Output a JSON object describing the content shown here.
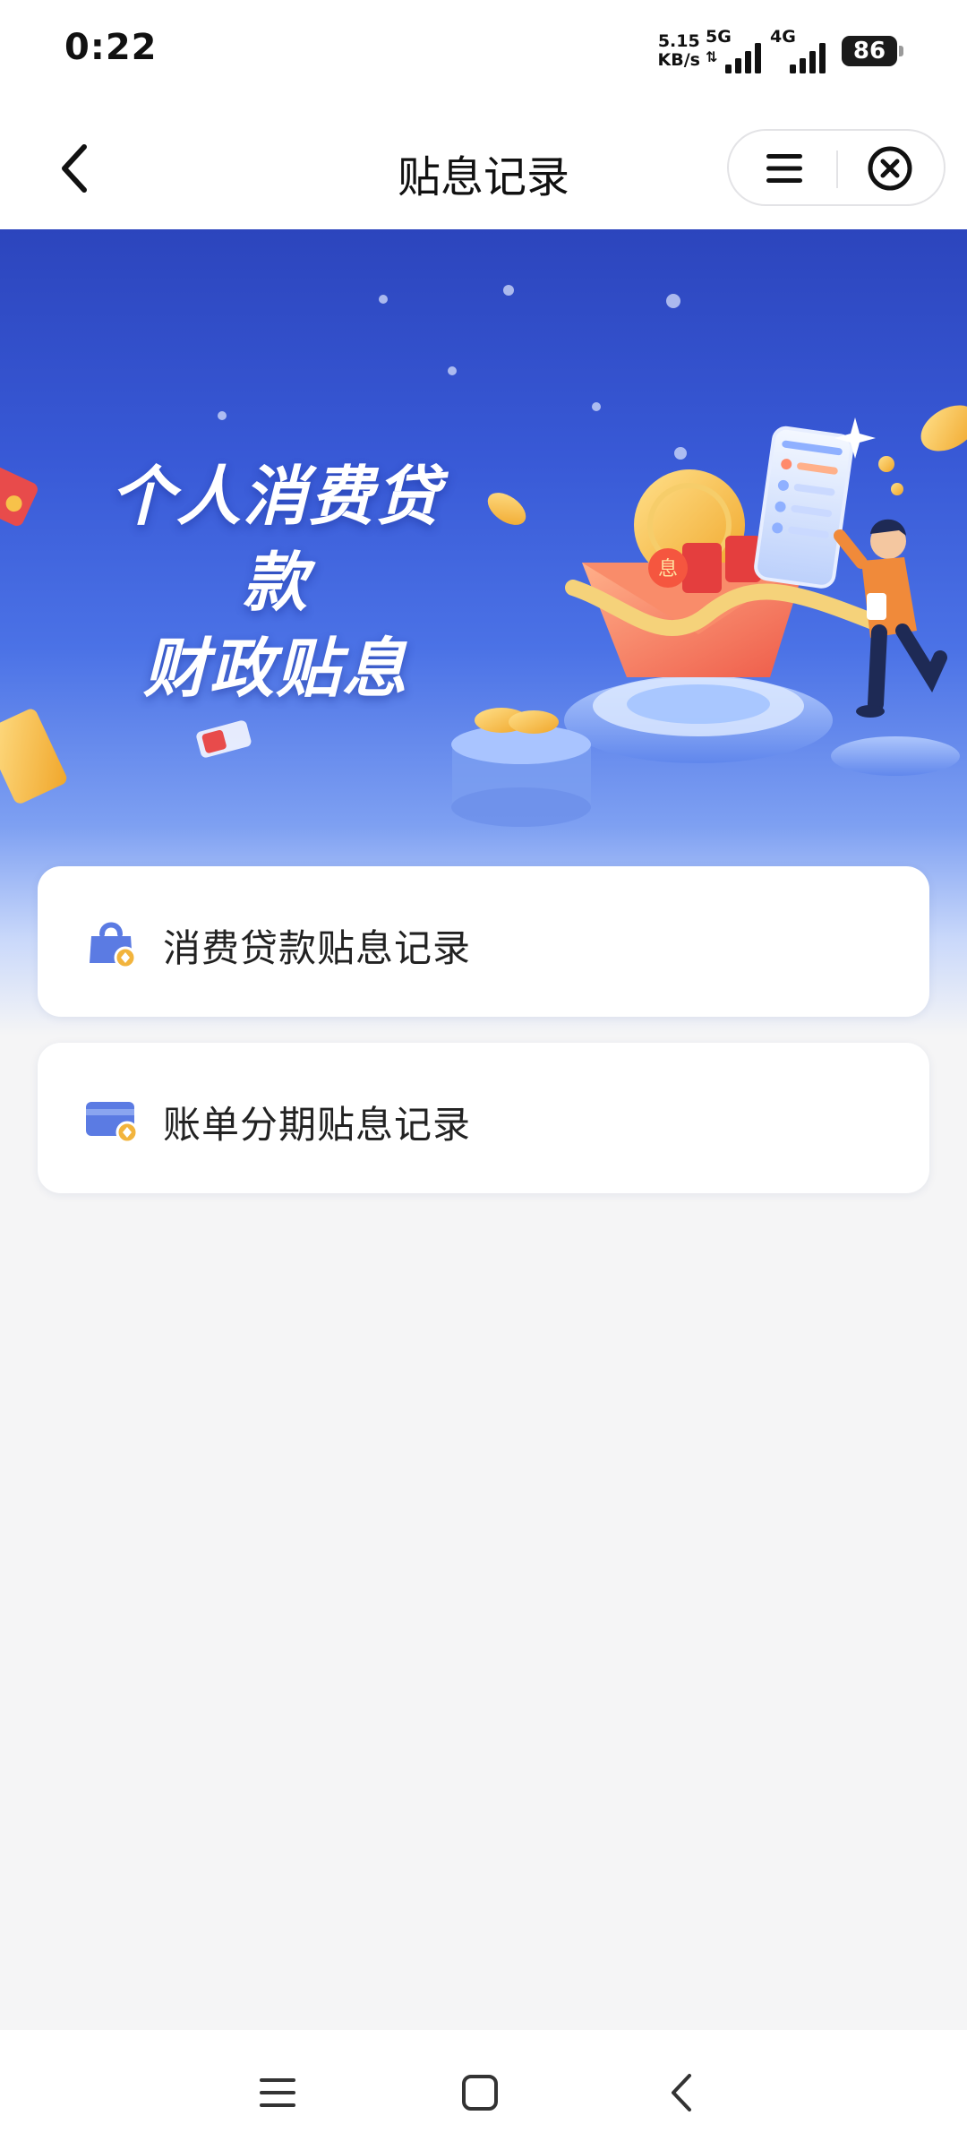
{
  "status_bar": {
    "time": "0:22",
    "net_speed_value": "5.15",
    "net_speed_unit": "KB/s",
    "signal_1_label": "5G",
    "signal_2_label": "4G",
    "battery_level": "86"
  },
  "header": {
    "title": "贴息记录",
    "back_icon": "chevron-left-icon",
    "menu_icon": "menu-icon",
    "close_icon": "close-circle-icon"
  },
  "banner": {
    "title_line1": "个人消费贷款",
    "title_line2": "财政贴息",
    "colors": {
      "top": "#2c45bd",
      "mid": "#4b72e6",
      "bottom": "#f5f5f6"
    }
  },
  "records": [
    {
      "label": "消费贷款贴息记录",
      "icon": "lock-bag-icon"
    },
    {
      "label": "账单分期贴息记录",
      "icon": "credit-card-icon"
    }
  ],
  "nav_bar": {
    "menu_icon": "recents-menu-icon",
    "home_icon": "home-square-icon",
    "back_icon": "back-chevron-icon"
  },
  "colors": {
    "accent_blue": "#5b7be3",
    "coin_gold": "#f2b43d",
    "page_background": "#f5f5f6"
  }
}
